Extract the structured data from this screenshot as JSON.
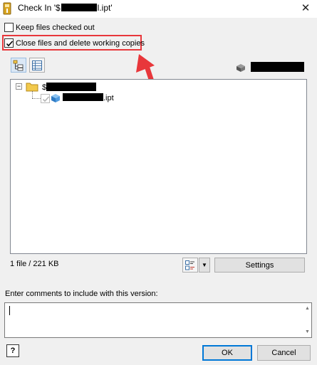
{
  "window": {
    "title_prefix": "Check In '$",
    "title_suffix": "l.ipt'",
    "close_glyph": "✕"
  },
  "options": {
    "keep_checked_out": {
      "label": "Keep files checked out",
      "checked": false
    },
    "close_and_delete": {
      "label": "Close files and delete working copies",
      "checked": true
    }
  },
  "toolbar": {
    "tree_view_icon": "tree-view-icon",
    "list_view_icon": "list-view-icon"
  },
  "tree": {
    "root": {
      "label_prefix": "$",
      "expander": "−"
    },
    "file": {
      "label_suffix": ".ipt"
    }
  },
  "status": {
    "summary": "1 file / 221 KB"
  },
  "buttons": {
    "settings": "Settings",
    "ok": "OK",
    "cancel": "Cancel",
    "help_glyph": "?",
    "dropdown_glyph": "▼"
  },
  "comments": {
    "label": "Enter comments to include with this version:",
    "value": "",
    "scroll_up": "▲",
    "scroll_down": "▼"
  },
  "colors": {
    "highlight": "#e8373b",
    "folder": "#f2c94c",
    "part_cube": "#3c8fd8",
    "default_button": "#0078d7"
  }
}
